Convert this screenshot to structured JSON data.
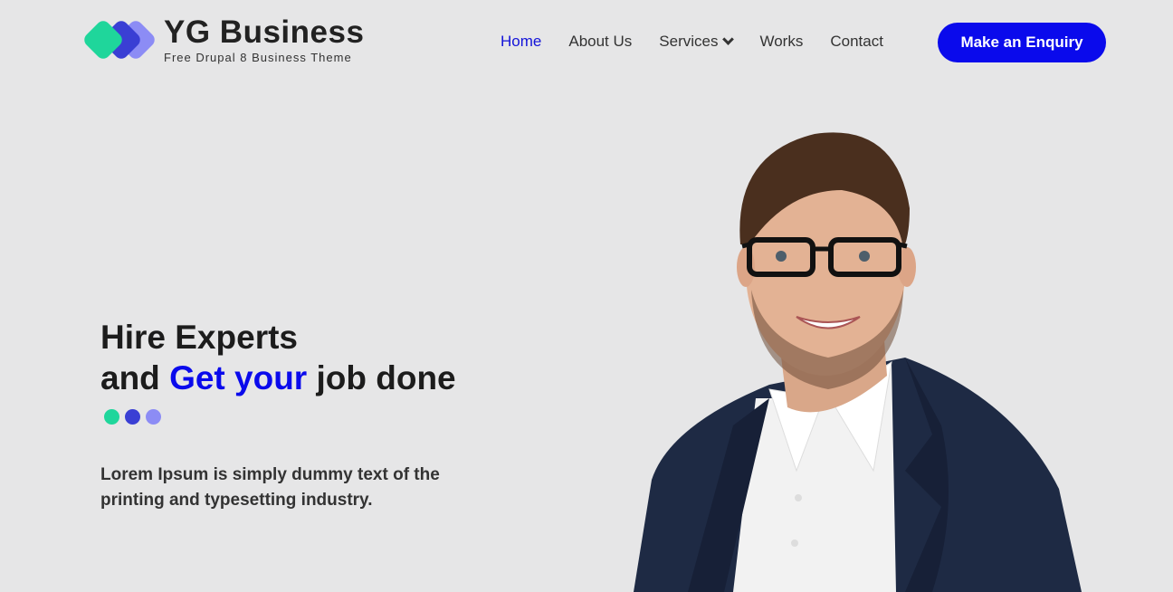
{
  "brand": {
    "title": "YG Business",
    "subtitle": "Free Drupal 8 Business Theme"
  },
  "nav": {
    "items": [
      {
        "label": "Home",
        "active": true
      },
      {
        "label": "About Us"
      },
      {
        "label": "Services",
        "has_dropdown": true
      },
      {
        "label": "Works"
      },
      {
        "label": "Contact"
      }
    ],
    "cta_label": "Make an Enquiry"
  },
  "hero": {
    "line1": "Hire Experts",
    "line2_prefix": "and",
    "line2_highlight": "Get your",
    "line2_suffix": "job done",
    "description": "Lorem Ipsum is simply dummy text of the printing and typesetting industry."
  },
  "colors": {
    "accent": "#0a0aec",
    "green": "#1fd69b",
    "indigo": "#3a3fd4",
    "lavender": "#8c8cf5",
    "background": "#e6e6e7"
  }
}
